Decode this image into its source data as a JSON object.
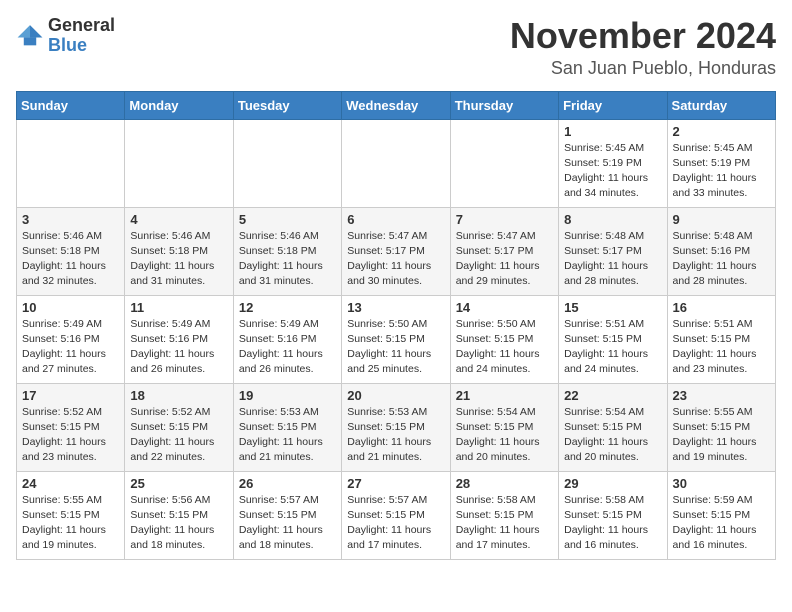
{
  "logo": {
    "general": "General",
    "blue": "Blue"
  },
  "title": "November 2024",
  "location": "San Juan Pueblo, Honduras",
  "days_of_week": [
    "Sunday",
    "Monday",
    "Tuesday",
    "Wednesday",
    "Thursday",
    "Friday",
    "Saturday"
  ],
  "weeks": [
    [
      {
        "day": "",
        "info": ""
      },
      {
        "day": "",
        "info": ""
      },
      {
        "day": "",
        "info": ""
      },
      {
        "day": "",
        "info": ""
      },
      {
        "day": "",
        "info": ""
      },
      {
        "day": "1",
        "info": "Sunrise: 5:45 AM\nSunset: 5:19 PM\nDaylight: 11 hours\nand 34 minutes."
      },
      {
        "day": "2",
        "info": "Sunrise: 5:45 AM\nSunset: 5:19 PM\nDaylight: 11 hours\nand 33 minutes."
      }
    ],
    [
      {
        "day": "3",
        "info": "Sunrise: 5:46 AM\nSunset: 5:18 PM\nDaylight: 11 hours\nand 32 minutes."
      },
      {
        "day": "4",
        "info": "Sunrise: 5:46 AM\nSunset: 5:18 PM\nDaylight: 11 hours\nand 31 minutes."
      },
      {
        "day": "5",
        "info": "Sunrise: 5:46 AM\nSunset: 5:18 PM\nDaylight: 11 hours\nand 31 minutes."
      },
      {
        "day": "6",
        "info": "Sunrise: 5:47 AM\nSunset: 5:17 PM\nDaylight: 11 hours\nand 30 minutes."
      },
      {
        "day": "7",
        "info": "Sunrise: 5:47 AM\nSunset: 5:17 PM\nDaylight: 11 hours\nand 29 minutes."
      },
      {
        "day": "8",
        "info": "Sunrise: 5:48 AM\nSunset: 5:17 PM\nDaylight: 11 hours\nand 28 minutes."
      },
      {
        "day": "9",
        "info": "Sunrise: 5:48 AM\nSunset: 5:16 PM\nDaylight: 11 hours\nand 28 minutes."
      }
    ],
    [
      {
        "day": "10",
        "info": "Sunrise: 5:49 AM\nSunset: 5:16 PM\nDaylight: 11 hours\nand 27 minutes."
      },
      {
        "day": "11",
        "info": "Sunrise: 5:49 AM\nSunset: 5:16 PM\nDaylight: 11 hours\nand 26 minutes."
      },
      {
        "day": "12",
        "info": "Sunrise: 5:49 AM\nSunset: 5:16 PM\nDaylight: 11 hours\nand 26 minutes."
      },
      {
        "day": "13",
        "info": "Sunrise: 5:50 AM\nSunset: 5:15 PM\nDaylight: 11 hours\nand 25 minutes."
      },
      {
        "day": "14",
        "info": "Sunrise: 5:50 AM\nSunset: 5:15 PM\nDaylight: 11 hours\nand 24 minutes."
      },
      {
        "day": "15",
        "info": "Sunrise: 5:51 AM\nSunset: 5:15 PM\nDaylight: 11 hours\nand 24 minutes."
      },
      {
        "day": "16",
        "info": "Sunrise: 5:51 AM\nSunset: 5:15 PM\nDaylight: 11 hours\nand 23 minutes."
      }
    ],
    [
      {
        "day": "17",
        "info": "Sunrise: 5:52 AM\nSunset: 5:15 PM\nDaylight: 11 hours\nand 23 minutes."
      },
      {
        "day": "18",
        "info": "Sunrise: 5:52 AM\nSunset: 5:15 PM\nDaylight: 11 hours\nand 22 minutes."
      },
      {
        "day": "19",
        "info": "Sunrise: 5:53 AM\nSunset: 5:15 PM\nDaylight: 11 hours\nand 21 minutes."
      },
      {
        "day": "20",
        "info": "Sunrise: 5:53 AM\nSunset: 5:15 PM\nDaylight: 11 hours\nand 21 minutes."
      },
      {
        "day": "21",
        "info": "Sunrise: 5:54 AM\nSunset: 5:15 PM\nDaylight: 11 hours\nand 20 minutes."
      },
      {
        "day": "22",
        "info": "Sunrise: 5:54 AM\nSunset: 5:15 PM\nDaylight: 11 hours\nand 20 minutes."
      },
      {
        "day": "23",
        "info": "Sunrise: 5:55 AM\nSunset: 5:15 PM\nDaylight: 11 hours\nand 19 minutes."
      }
    ],
    [
      {
        "day": "24",
        "info": "Sunrise: 5:55 AM\nSunset: 5:15 PM\nDaylight: 11 hours\nand 19 minutes."
      },
      {
        "day": "25",
        "info": "Sunrise: 5:56 AM\nSunset: 5:15 PM\nDaylight: 11 hours\nand 18 minutes."
      },
      {
        "day": "26",
        "info": "Sunrise: 5:57 AM\nSunset: 5:15 PM\nDaylight: 11 hours\nand 18 minutes."
      },
      {
        "day": "27",
        "info": "Sunrise: 5:57 AM\nSunset: 5:15 PM\nDaylight: 11 hours\nand 17 minutes."
      },
      {
        "day": "28",
        "info": "Sunrise: 5:58 AM\nSunset: 5:15 PM\nDaylight: 11 hours\nand 17 minutes."
      },
      {
        "day": "29",
        "info": "Sunrise: 5:58 AM\nSunset: 5:15 PM\nDaylight: 11 hours\nand 16 minutes."
      },
      {
        "day": "30",
        "info": "Sunrise: 5:59 AM\nSunset: 5:15 PM\nDaylight: 11 hours\nand 16 minutes."
      }
    ]
  ]
}
